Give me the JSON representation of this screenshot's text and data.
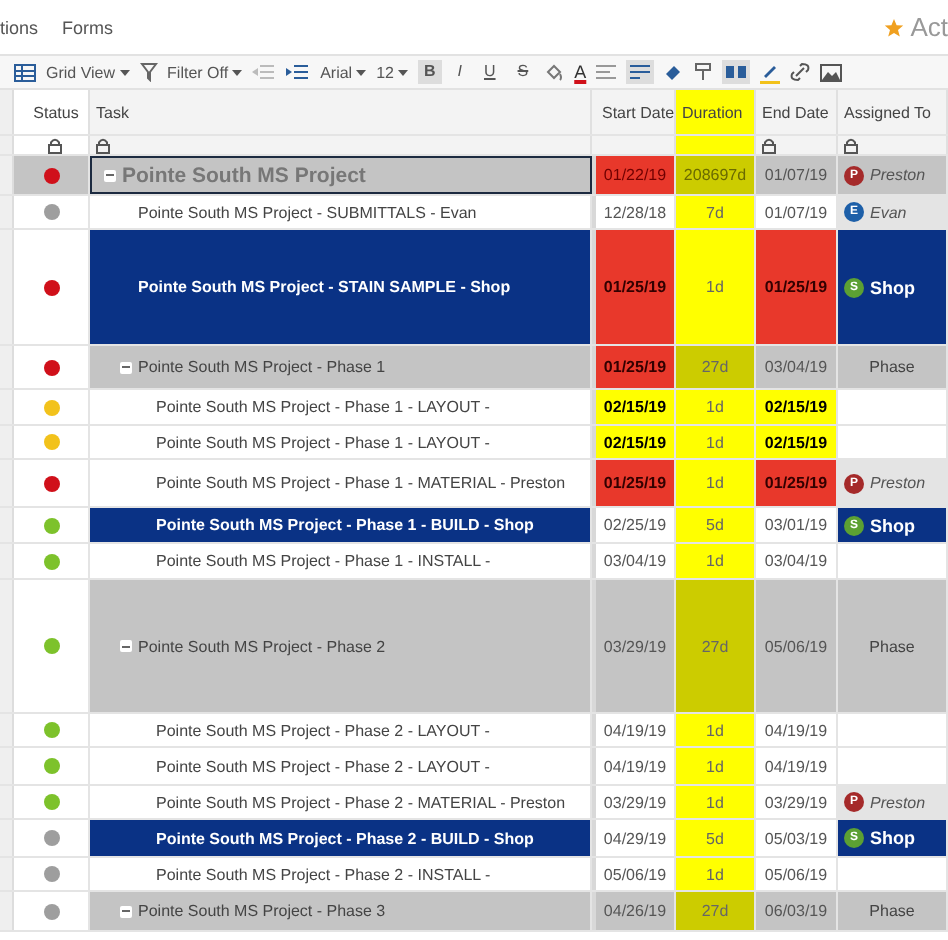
{
  "menu": {
    "items": [
      "tions",
      "Forms"
    ],
    "right_label": "Act"
  },
  "toolbar": {
    "view": "Grid View",
    "filter": "Filter Off",
    "font": "Arial",
    "size": "12",
    "format_buttons": [
      {
        "label": "B",
        "selected": true
      },
      {
        "label": "I",
        "selected": false
      },
      {
        "label": "U",
        "selected": false
      },
      {
        "label": "S",
        "selected": false
      }
    ],
    "text_color_label": "A"
  },
  "columns": [
    {
      "label": "Status",
      "locked": true,
      "highlight": false
    },
    {
      "label": "Task",
      "locked": true,
      "highlight": false
    },
    {
      "label": "Start Date",
      "locked": false,
      "highlight": false
    },
    {
      "label": "Duration",
      "locked": false,
      "highlight": true
    },
    {
      "label": "End Date",
      "locked": true,
      "highlight": false
    },
    {
      "label": "Assigned To",
      "locked": true,
      "highlight": false
    }
  ],
  "rows": [
    {
      "kind": "project",
      "task": "Pointe South MS Project",
      "color": "#d0101a",
      "start": "01/22/19",
      "start_overdue": true,
      "start_due": false,
      "duration": "208697d",
      "end": "01/07/19",
      "end_overdue": false,
      "end_due": false,
      "assigned": {
        "name": "Preston",
        "initial": "P",
        "color": "#a52a2a"
      },
      "expanded": true,
      "selected": true,
      "children": [
        {
          "kind": "task",
          "task": "Pointe South MS Project - SUBMITTALS - Evan",
          "color": "#9e9e9e",
          "start": "12/28/18",
          "start_overdue": false,
          "start_due": false,
          "duration": "7d",
          "end": "01/07/19",
          "end_overdue": false,
          "end_due": false,
          "assigned": {
            "name": "Evan",
            "initial": "E",
            "color": "#1d5fa8"
          },
          "selected": false
        },
        {
          "kind": "highlight",
          "task": "Pointe South MS Project - STAIN SAMPLE - Shop",
          "color": "#d0101a",
          "start": "01/25/19",
          "start_overdue": true,
          "start_due": true,
          "duration": "1d",
          "end": "01/25/19",
          "end_overdue": true,
          "end_due": true,
          "assigned": {
            "name": "Shop",
            "initial": "S",
            "color": "#5ca033"
          },
          "selected": false
        },
        {
          "kind": "phase",
          "task": "Pointe South MS Project - Phase 1",
          "color": "#d0101a",
          "start": "01/25/19",
          "start_overdue": true,
          "start_due": true,
          "duration": "27d",
          "end": "03/04/19",
          "end_overdue": false,
          "end_due": false,
          "assigned": {
            "name": "Phase"
          },
          "expanded": true,
          "selected": false,
          "children": [
            {
              "kind": "task",
              "task": "Pointe South MS Project - Phase 1 - LAYOUT -",
              "color": "#f2c21b",
              "start": "02/15/19",
              "start_overdue": false,
              "start_due": true,
              "duration": "1d",
              "end": "02/15/19",
              "end_overdue": false,
              "end_due": true,
              "selected": false
            },
            {
              "kind": "task",
              "task": "Pointe South MS Project - Phase 1 - LAYOUT -",
              "color": "#f2c21b",
              "start": "02/15/19",
              "start_overdue": false,
              "start_due": true,
              "duration": "1d",
              "end": "02/15/19",
              "end_overdue": false,
              "end_due": true,
              "selected": false
            },
            {
              "kind": "task",
              "task": "Pointe South MS Project - Phase 1 - MATERIAL - Preston",
              "color": "#d0101a",
              "start": "01/25/19",
              "start_overdue": true,
              "start_due": true,
              "duration": "1d",
              "end": "01/25/19",
              "end_overdue": true,
              "end_due": true,
              "assigned": {
                "name": "Preston",
                "initial": "P",
                "color": "#a52a2a"
              },
              "selected": false
            },
            {
              "kind": "highlight",
              "task": "Pointe South MS Project - Phase 1 - BUILD - Shop",
              "color": "#7dc22b",
              "start": "02/25/19",
              "start_overdue": false,
              "start_due": false,
              "duration": "5d",
              "end": "03/01/19",
              "end_overdue": false,
              "end_due": false,
              "assigned": {
                "name": "Shop",
                "initial": "S",
                "color": "#5ca033"
              },
              "selected": false
            },
            {
              "kind": "task",
              "task": "Pointe South MS Project - Phase 1 - INSTALL -",
              "color": "#7dc22b",
              "start": "03/04/19",
              "start_overdue": false,
              "start_due": false,
              "duration": "1d",
              "end": "03/04/19",
              "end_overdue": false,
              "end_due": false,
              "selected": false
            }
          ]
        },
        {
          "kind": "phase",
          "task": "Pointe South MS Project - Phase 2",
          "color": "#7dc22b",
          "start": "03/29/19",
          "start_overdue": false,
          "start_due": false,
          "duration": "27d",
          "end": "05/06/19",
          "end_overdue": false,
          "end_due": false,
          "assigned": {
            "name": "Phase"
          },
          "expanded": true,
          "selected": false,
          "children": [
            {
              "kind": "task",
              "task": "Pointe South MS Project - Phase 2 - LAYOUT -",
              "color": "#7dc22b",
              "start": "04/19/19",
              "start_overdue": false,
              "start_due": false,
              "duration": "1d",
              "end": "04/19/19",
              "end_overdue": false,
              "end_due": false,
              "selected": false
            },
            {
              "kind": "task",
              "task": "Pointe South MS Project - Phase 2 - LAYOUT -",
              "color": "#7dc22b",
              "start": "04/19/19",
              "start_overdue": false,
              "start_due": false,
              "duration": "1d",
              "end": "04/19/19",
              "end_overdue": false,
              "end_due": false,
              "selected": false
            },
            {
              "kind": "task",
              "task": "Pointe South MS Project - Phase 2 - MATERIAL - Preston",
              "color": "#7dc22b",
              "start": "03/29/19",
              "start_overdue": false,
              "start_due": false,
              "duration": "1d",
              "end": "03/29/19",
              "end_overdue": false,
              "end_due": false,
              "assigned": {
                "name": "Preston",
                "initial": "P",
                "color": "#a52a2a"
              },
              "selected": false
            },
            {
              "kind": "highlight",
              "task": "Pointe South MS Project - Phase 2 - BUILD - Shop",
              "color": "#9e9e9e",
              "start": "04/29/19",
              "start_overdue": false,
              "start_due": false,
              "duration": "5d",
              "end": "05/03/19",
              "end_overdue": false,
              "end_due": false,
              "assigned": {
                "name": "Shop",
                "initial": "S",
                "color": "#5ca033"
              },
              "selected": false
            },
            {
              "kind": "task",
              "task": "Pointe South MS Project - Phase 2 - INSTALL -",
              "color": "#9e9e9e",
              "start": "05/06/19",
              "start_overdue": false,
              "start_due": false,
              "duration": "1d",
              "end": "05/06/19",
              "end_overdue": false,
              "end_due": false,
              "selected": false
            }
          ]
        },
        {
          "kind": "phase",
          "task": "Pointe South MS Project - Phase 3",
          "color": "#9e9e9e",
          "start": "04/26/19",
          "start_overdue": false,
          "start_due": false,
          "duration": "27d",
          "end": "06/03/19",
          "end_overdue": false,
          "end_due": false,
          "assigned": {
            "name": "Phase"
          },
          "expanded": true,
          "selected": false
        }
      ]
    }
  ]
}
